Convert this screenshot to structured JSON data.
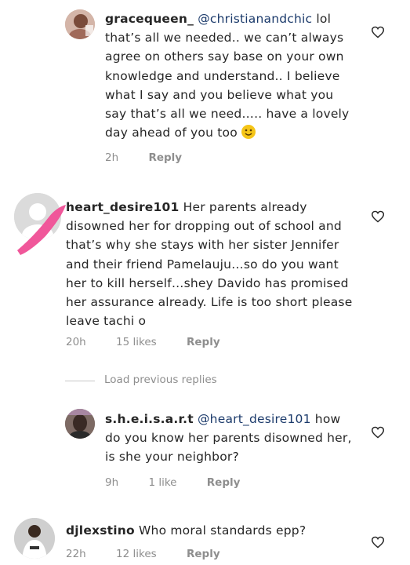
{
  "comments": [
    {
      "username": "gracequeen_",
      "mention": "@christianandchic",
      "text": "lol that’s all we needed.. we can’t always agree on others say base on your own knowledge and understand.. I believe what I say and you believe what you say that’s all we need….. have a lovely day ahead of you too",
      "time": "2h",
      "likes": "",
      "reply": "Reply",
      "emoji": "smiling-face-emoji"
    },
    {
      "username": "heart_desire101",
      "mention": "",
      "text": "Her parents already disowned her for dropping out of school and that’s why she stays with her sister Jennifer and their friend Pamelauju…so do you want her to kill herself…shey Davido has promised her assurance already. Life is too short please leave tachi o",
      "time": "20h",
      "likes": "15 likes",
      "reply": "Reply"
    },
    {
      "username": "s.h.e.i.s.a.r.t",
      "mention": "@heart_desire101",
      "text": "how do you know her parents disowned her, is she your neighbor?",
      "time": "9h",
      "likes": "1 like",
      "reply": "Reply"
    },
    {
      "username": "djlexstino",
      "mention": "",
      "text": "Who moral standards epp?",
      "time": "22h",
      "likes": "12 likes",
      "reply": "Reply"
    }
  ],
  "load_previous": "Load previous replies",
  "colors": {
    "mention": "#1b3a6b",
    "meta": "#8e8e8e",
    "pink_mark": "#f0579a",
    "emoji": "#f5c518"
  }
}
